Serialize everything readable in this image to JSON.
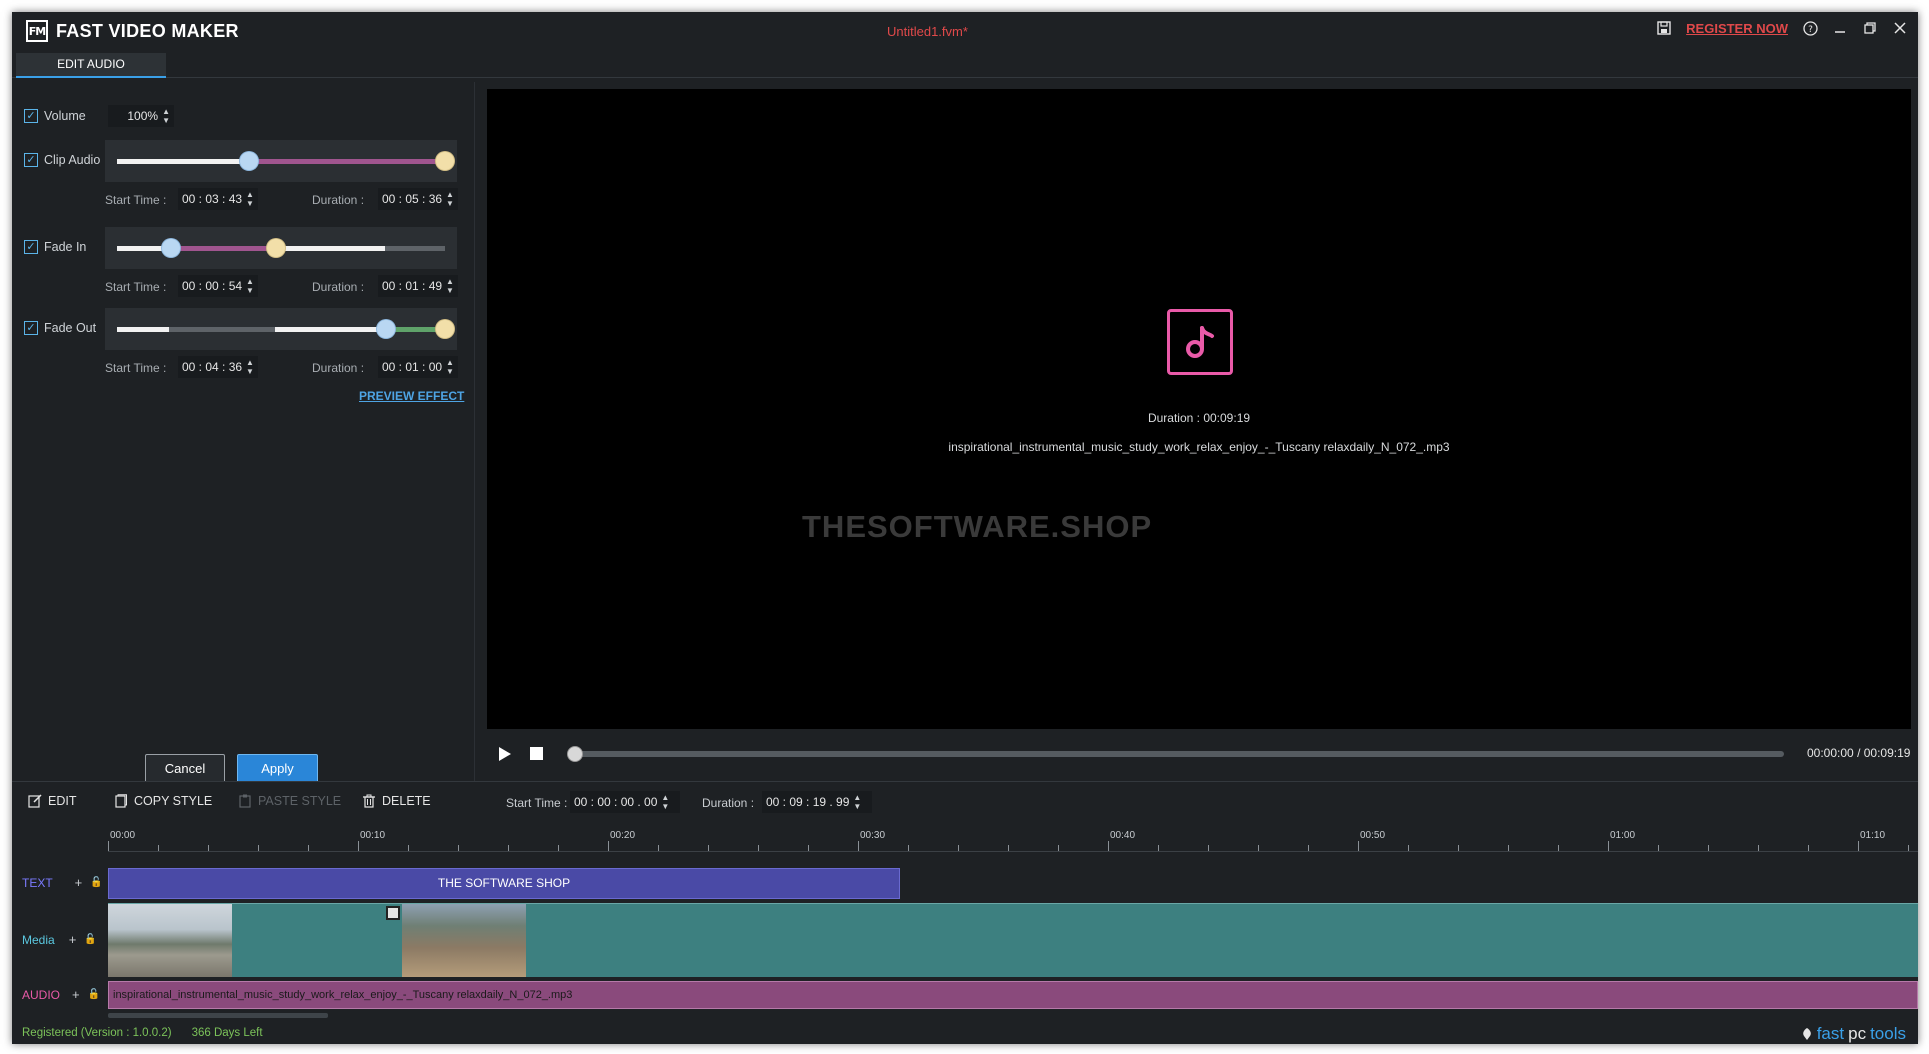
{
  "titlebar": {
    "app_name": "FAST VIDEO MAKER",
    "logo_text": "FM",
    "document": "Untitled1.fvm*",
    "register": "REGISTER NOW"
  },
  "tabs": {
    "edit_audio": "EDIT AUDIO"
  },
  "edit_audio": {
    "volume": {
      "label": "Volume",
      "value": "100%",
      "checked": true
    },
    "clip_audio": {
      "label": "Clip Audio",
      "checked": true,
      "start_label": "Start Time :",
      "start_value": "00 : 03 : 43",
      "duration_label": "Duration :",
      "duration_value": "00 : 05 : 36",
      "range": [
        0.4,
        1.0
      ]
    },
    "fade_in": {
      "label": "Fade In",
      "checked": true,
      "start_label": "Start Time :",
      "start_value": "00 : 00 : 54",
      "duration_label": "Duration :",
      "duration_value": "00 : 01 : 49"
    },
    "fade_out": {
      "label": "Fade Out",
      "checked": true,
      "start_label": "Start Time :",
      "start_value": "00 : 04 : 36",
      "duration_label": "Duration :",
      "duration_value": "00 : 01 : 00"
    },
    "preview_effect": "PREVIEW EFFECT",
    "cancel": "Cancel",
    "apply": "Apply"
  },
  "preview": {
    "duration_label": "Duration :",
    "duration_value": "00:09:19",
    "filename": "inspirational_instrumental_music_study_work_relax_enjoy_-_Tuscany relaxdaily_N_072_.mp3",
    "watermark": "THESOFTWARE.SHOP",
    "icon": "music-note-icon"
  },
  "player": {
    "current": "00:00:00",
    "separator": "/",
    "total": "00:09:19",
    "position": 0
  },
  "toolbar": {
    "edit": "EDIT",
    "copy_style": "COPY STYLE",
    "paste_style": "PASTE STYLE",
    "delete": "DELETE",
    "start_label": "Start Time :",
    "start_value": "00 : 00 : 00 . 00",
    "duration_label": "Duration :",
    "duration_value": "00 : 09 : 19 . 99"
  },
  "timeline": {
    "ticks": [
      "00:00",
      "00:10",
      "00:20",
      "00:30",
      "00:40",
      "00:50",
      "01:00",
      "01:10"
    ],
    "tracks": {
      "text": {
        "label": "TEXT",
        "clip": "THE SOFTWARE SHOP",
        "color": "#7b7bff"
      },
      "media": {
        "label": "Media",
        "color": "#5bc8e0"
      },
      "audio": {
        "label": "AUDIO",
        "clip": "inspirational_instrumental_music_study_work_relax_enjoy_-_Tuscany relaxdaily_N_072_.mp3",
        "color": "#e95aa8"
      }
    }
  },
  "status": {
    "registered": "Registered (Version : 1.0.0.2)",
    "days_left": "366 Days Left",
    "brand_fast": "fast",
    "brand_pc": "pc",
    "brand_tools": "tools"
  },
  "colors": {
    "accent": "#2a86d8",
    "register_red": "#e0494a",
    "clip_purple": "#8a4a7c",
    "media_teal": "#3d8080",
    "text_clip": "#4a4aa6"
  }
}
